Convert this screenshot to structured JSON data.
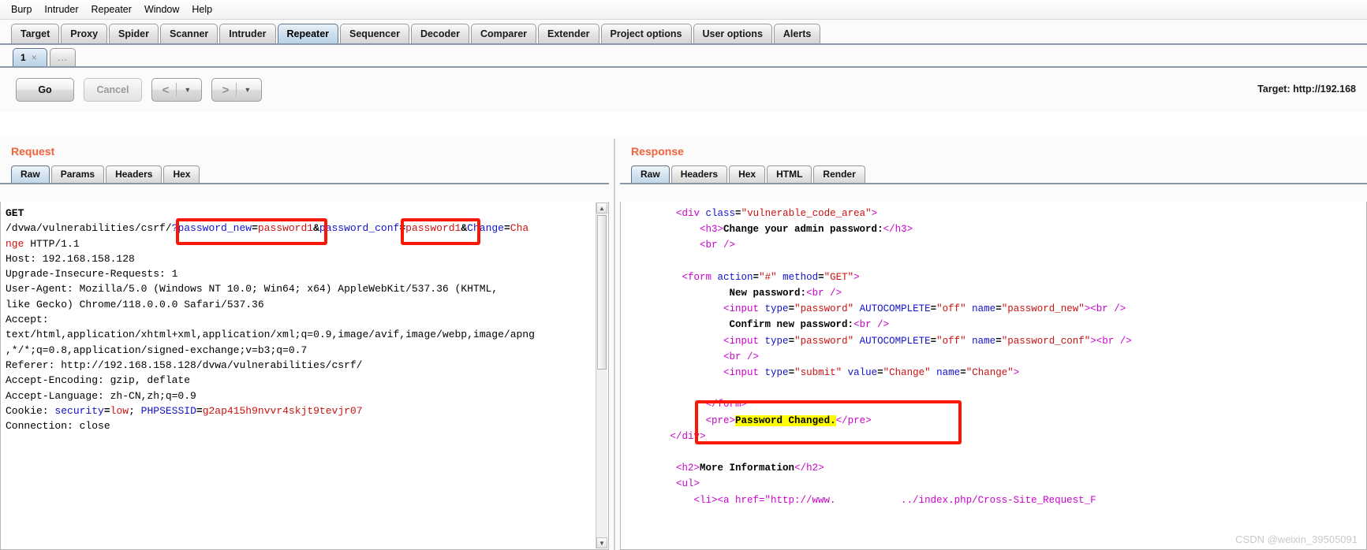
{
  "menu": {
    "items": [
      "Burp",
      "Intruder",
      "Repeater",
      "Window",
      "Help"
    ]
  },
  "main_tabs": {
    "selected": "Repeater",
    "items": [
      "Target",
      "Proxy",
      "Spider",
      "Scanner",
      "Intruder",
      "Repeater",
      "Sequencer",
      "Decoder",
      "Comparer",
      "Extender",
      "Project options",
      "User options",
      "Alerts"
    ]
  },
  "repeater_tabs": {
    "items": [
      {
        "label": "1",
        "close": "×",
        "selected": true
      },
      {
        "label": "...",
        "close": "",
        "selected": false
      }
    ]
  },
  "toolbar": {
    "go_label": "Go",
    "cancel_label": "Cancel",
    "back_arrow": "<",
    "back_caret": "▼",
    "forward_arrow": ">",
    "forward_caret": "▼",
    "target_label": "Target: http://192.168"
  },
  "request": {
    "title": "Request",
    "tabs": [
      "Raw",
      "Params",
      "Headers",
      "Hex"
    ],
    "selected_tab": "Raw",
    "lines": {
      "method": "GET",
      "path_prefix": "/dvwa/vulnerabilities/csrf/",
      "query_password_new_key": "?password_new",
      "query_eq1": "=",
      "query_password_new_val": "password1",
      "query_amp1": "&",
      "query_password_conf_key": "password_conf",
      "query_eq2": "=",
      "query_password_conf_val": "password1",
      "query_amp2": "&",
      "query_change_key": "Change",
      "query_eq3": "=",
      "query_change_val": "Cha",
      "line2_cont": "nge",
      "line2_proto": " HTTP/1.1",
      "host": "Host: 192.168.158.128",
      "upgrade": "Upgrade-Insecure-Requests: 1",
      "ua1": "User-Agent: Mozilla/5.0 (Windows NT 10.0; Win64; x64) AppleWebKit/537.36 (KHTML,",
      "ua2": "like Gecko) Chrome/118.0.0.0 Safari/537.36",
      "accept": "Accept:",
      "accept_val1": "text/html,application/xhtml+xml,application/xml;q=0.9,image/avif,image/webp,image/apng",
      "accept_val2": ",*/*;q=0.8,application/signed-exchange;v=b3;q=0.7",
      "referer": "Referer: http://192.168.158.128/dvwa/vulnerabilities/csrf/",
      "accept_encoding": "Accept-Encoding: gzip, deflate",
      "accept_language": "Accept-Language: zh-CN,zh;q=0.9",
      "cookie_label": "Cookie: ",
      "cookie_key1": "security",
      "cookie_eq1": "=",
      "cookie_val1": "low",
      "cookie_sep": "; ",
      "cookie_key2": "PHPSESSID",
      "cookie_eq2": "=",
      "cookie_val2": "g2ap415h9nvvr4skjt9tevjr07",
      "connection": "Connection: close"
    }
  },
  "response": {
    "title": "Response",
    "tabs": [
      "Raw",
      "Headers",
      "Hex",
      "HTML",
      "Render"
    ],
    "selected_tab": "Raw",
    "lines": {
      "l1_tag_open": "<div ",
      "l1_attr": "class",
      "l1_eq": "=",
      "l1_val": "\"vulnerable_code_area\"",
      "l1_tag_close": ">",
      "l2_h3_open": "<h3>",
      "l2_text": "Change your admin password:",
      "l2_h3_close": "</h3>",
      "l3_br": "<br />",
      "l4_form_open": "<form ",
      "l4_attr1": "action",
      "l4_val1": "\"#\"",
      "l4_attr2": "method",
      "l4_val2": "\"GET\"",
      "l4_close": ">",
      "l5_text": "New password:",
      "l5_br": "<br />",
      "l6_input": "<input ",
      "l6_a1": "type",
      "l6_v1": "\"password\"",
      "l6_a2": "AUTOCOMPLETE",
      "l6_v2": "\"off\"",
      "l6_a3": "name",
      "l6_v3": "\"password_new\"",
      "l6_end": ">",
      "l6_br": "<br />",
      "l7_text": "Confirm new password:",
      "l7_br": "<br />",
      "l8_input": "<input ",
      "l8_a1": "type",
      "l8_v1": "\"password\"",
      "l8_a2": "AUTOCOMPLETE",
      "l8_v2": "\"off\"",
      "l8_a3": "name",
      "l8_v3": "\"password_conf\"",
      "l8_end": ">",
      "l8_br": "<br />",
      "l9_br": "<br />",
      "l10_input": "<input ",
      "l10_a1": "type",
      "l10_v1": "\"submit\"",
      "l10_a2": "value",
      "l10_v2": "\"Change\"",
      "l10_a3": "name",
      "l10_v3": "\"Change\"",
      "l10_end": ">",
      "l11_form_close": "</form>",
      "l12_pre_open": "<pre>",
      "l12_highlight": "Password Changed.",
      "l12_pre_close": "</pre>",
      "l13_div_close": "</div>",
      "l14_h2_open": "<h2>",
      "l14_text": "More Information",
      "l14_h2_close": "</h2>",
      "l15_ul": "<ul>",
      "l16_partial": "<li><a href=\"http://www.           ../index.php/Cross-Site_Request_F"
    }
  },
  "watermark": "CSDN @weixin_39505091",
  "colors": {
    "accent_orange": "#f4613b",
    "annotation_red": "#fa1703",
    "highlight_yellow": "#ffff00",
    "selected_tab_blue": "#c8dcec"
  }
}
